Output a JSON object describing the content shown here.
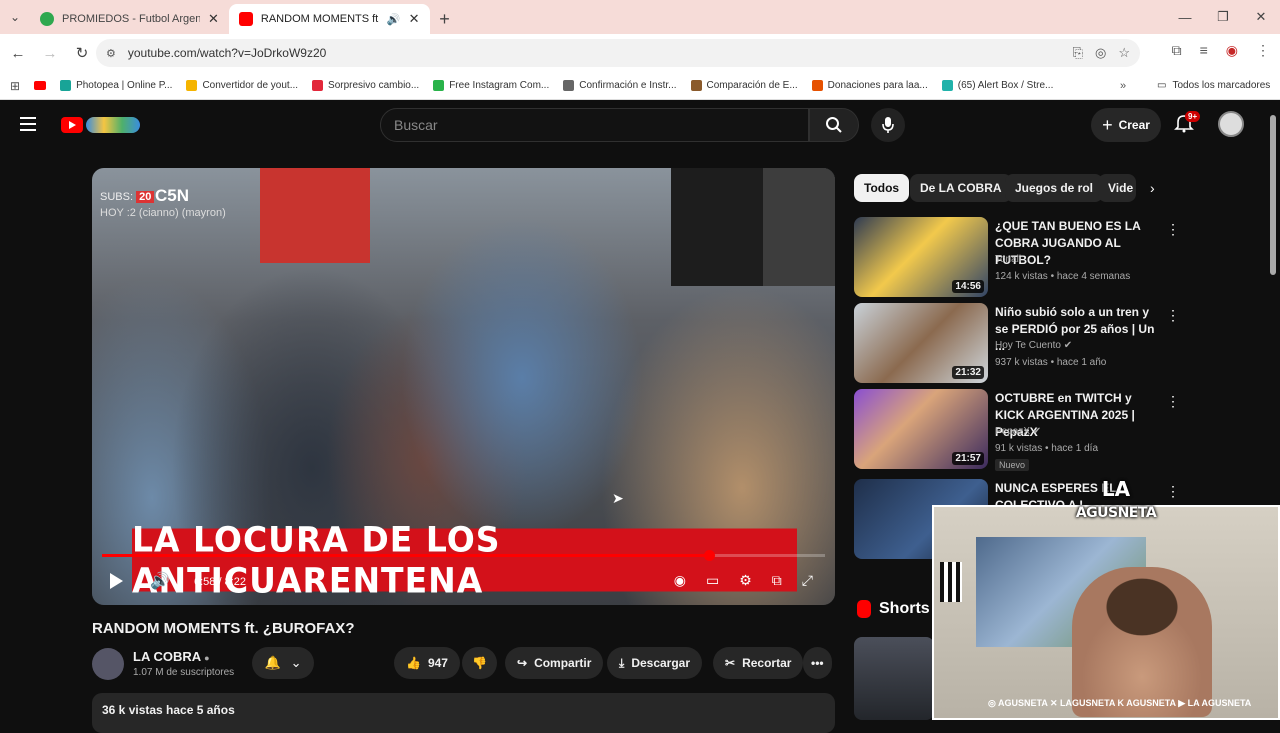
{
  "browser": {
    "tabs": [
      {
        "title": "PROMIEDOS - Futbol Argentino",
        "active": false
      },
      {
        "title": "RANDOM MOMENTS ft. ¿BUROFAX?",
        "active": true
      }
    ],
    "url": "youtube.com/watch?v=JoDrkoW9z20",
    "bookmarks": [
      {
        "label": "Photopea | Online P...",
        "icon_color": "#18a497"
      },
      {
        "label": "Convertidor de yout...",
        "icon_color": "#f5b400"
      },
      {
        "label": "Sorpresivo cambio...",
        "icon_color": "#e2273a"
      },
      {
        "label": "Free Instagram Com...",
        "icon_color": "#29b34a"
      },
      {
        "label": "Confirmación e Instr...",
        "icon_color": "#666666"
      },
      {
        "label": "Comparación de E...",
        "icon_color": "#8a5a2b"
      },
      {
        "label": "Donaciones para laa...",
        "icon_color": "#e65100"
      },
      {
        "label": "(65) Alert Box / Stre...",
        "icon_color": "#20b2aa"
      }
    ],
    "all_bookmarks_label": "Todos los marcadores"
  },
  "youtube": {
    "search_placeholder": "Buscar",
    "create_label": "Crear",
    "notif_badge": "9+"
  },
  "player": {
    "overlay_subs": "SUBS:",
    "overlay_num": "20",
    "channel_logo_text": "C5N",
    "overlay_hoy": "HOY :2 (cianno) (mayron)",
    "banner_text": "LA LOCURA DE LOS ANTICUARENTENA",
    "time": "6:58 / 8:22",
    "progress_fraction": 0.84
  },
  "video": {
    "title": "RANDOM MOMENTS ft. ¿BUROFAX?",
    "channel": "LA COBRA",
    "subscribers": "1.07 M de suscriptores",
    "likes": "947",
    "share_label": "Compartir",
    "download_label": "Descargar",
    "clip_label": "Recortar",
    "description_meta": "36 k vistas  hace 5 años"
  },
  "chips": [
    "Todos",
    "De LA COBRA",
    "Juegos de rol",
    "Vide"
  ],
  "recommendations": [
    {
      "title": "¿QUE TAN BUENO ES LA COBRA JUGANDO AL FUTBOL?",
      "channel": "Tonali",
      "meta": "124 k vistas • hace 4 semanas",
      "duration": "14:56",
      "badge": ""
    },
    {
      "title": "Niño subió solo a un tren y se PERDIÓ por 25 años | Un ...",
      "channel": "Hoy Te Cuento ✔",
      "meta": "937 k vistas • hace 1 año",
      "duration": "21:32",
      "badge": ""
    },
    {
      "title": "OCTUBRE en TWITCH y KICK ARGENTINA 2025 | PepazX",
      "channel": "PepazX ✔",
      "meta": "91 k vistas • hace 1 día",
      "duration": "21:57",
      "badge": "Nuevo"
    },
    {
      "title": "NUNCA ESPERES EL COLECTIVO A L...",
      "channel": "",
      "meta": "",
      "duration": "",
      "badge": ""
    }
  ],
  "shorts_label": "Shorts",
  "webcam": {
    "brand_line1": "LA",
    "brand_line2": "AGUSNETA",
    "socials": "◎ AGUSNETA  ✕ LAGUSNETA  K AGUSNETA  ▶ LA AGUSNETA"
  }
}
